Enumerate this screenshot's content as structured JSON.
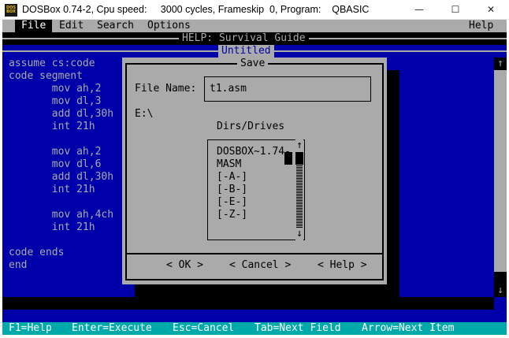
{
  "window": {
    "title": "DOSBox 0.74-2, Cpu speed:     3000 cycles, Frameskip  0, Program:    QBASIC",
    "icon_text": "DOS BOX",
    "minimize": "—",
    "maximize": "☐",
    "close": "✕"
  },
  "menu": {
    "file": "File",
    "edit": "Edit",
    "search": "Search",
    "options": "Options",
    "help": "Help"
  },
  "help_bar": {
    "title": "HELP: Survival Guide"
  },
  "editor": {
    "title": "Untitled",
    "lines": [
      "assume cs:code",
      "code segment",
      "       mov ah,2",
      "       mov dl,3",
      "       add dl,30h",
      "       int 21h",
      "",
      "       mov ah,2",
      "       mov dl,6",
      "       add dl,30h",
      "       int 21h",
      "",
      "       mov ah,4ch",
      "       int 21h",
      "",
      "code ends",
      "end"
    ],
    "scroll_up": "↑",
    "scroll_down": "↓"
  },
  "dialog": {
    "title": "Save",
    "file_name_label": "File Name:",
    "file_name_value": "t1.asm",
    "path": "E:\\",
    "dirs_label": "Dirs/Drives",
    "dir_items": [
      "DOSBOX~1.74-",
      "MASM",
      "[-A-]",
      "[-B-]",
      "[-E-]",
      "[-Z-]"
    ],
    "list_up": "↑",
    "list_down": "↓",
    "ok": "< OK >",
    "cancel": "< Cancel >",
    "help": "< Help >"
  },
  "status": {
    "f1": "F1=Help",
    "enter": "Enter=Execute",
    "esc": "Esc=Cancel",
    "tab": "Tab=Next Field",
    "arrow": "Arrow=Next Item"
  },
  "colors": {
    "dos_blue": "#0000aa",
    "dos_gray": "#aaaaaa",
    "status_cyan": "#00aaaa"
  }
}
